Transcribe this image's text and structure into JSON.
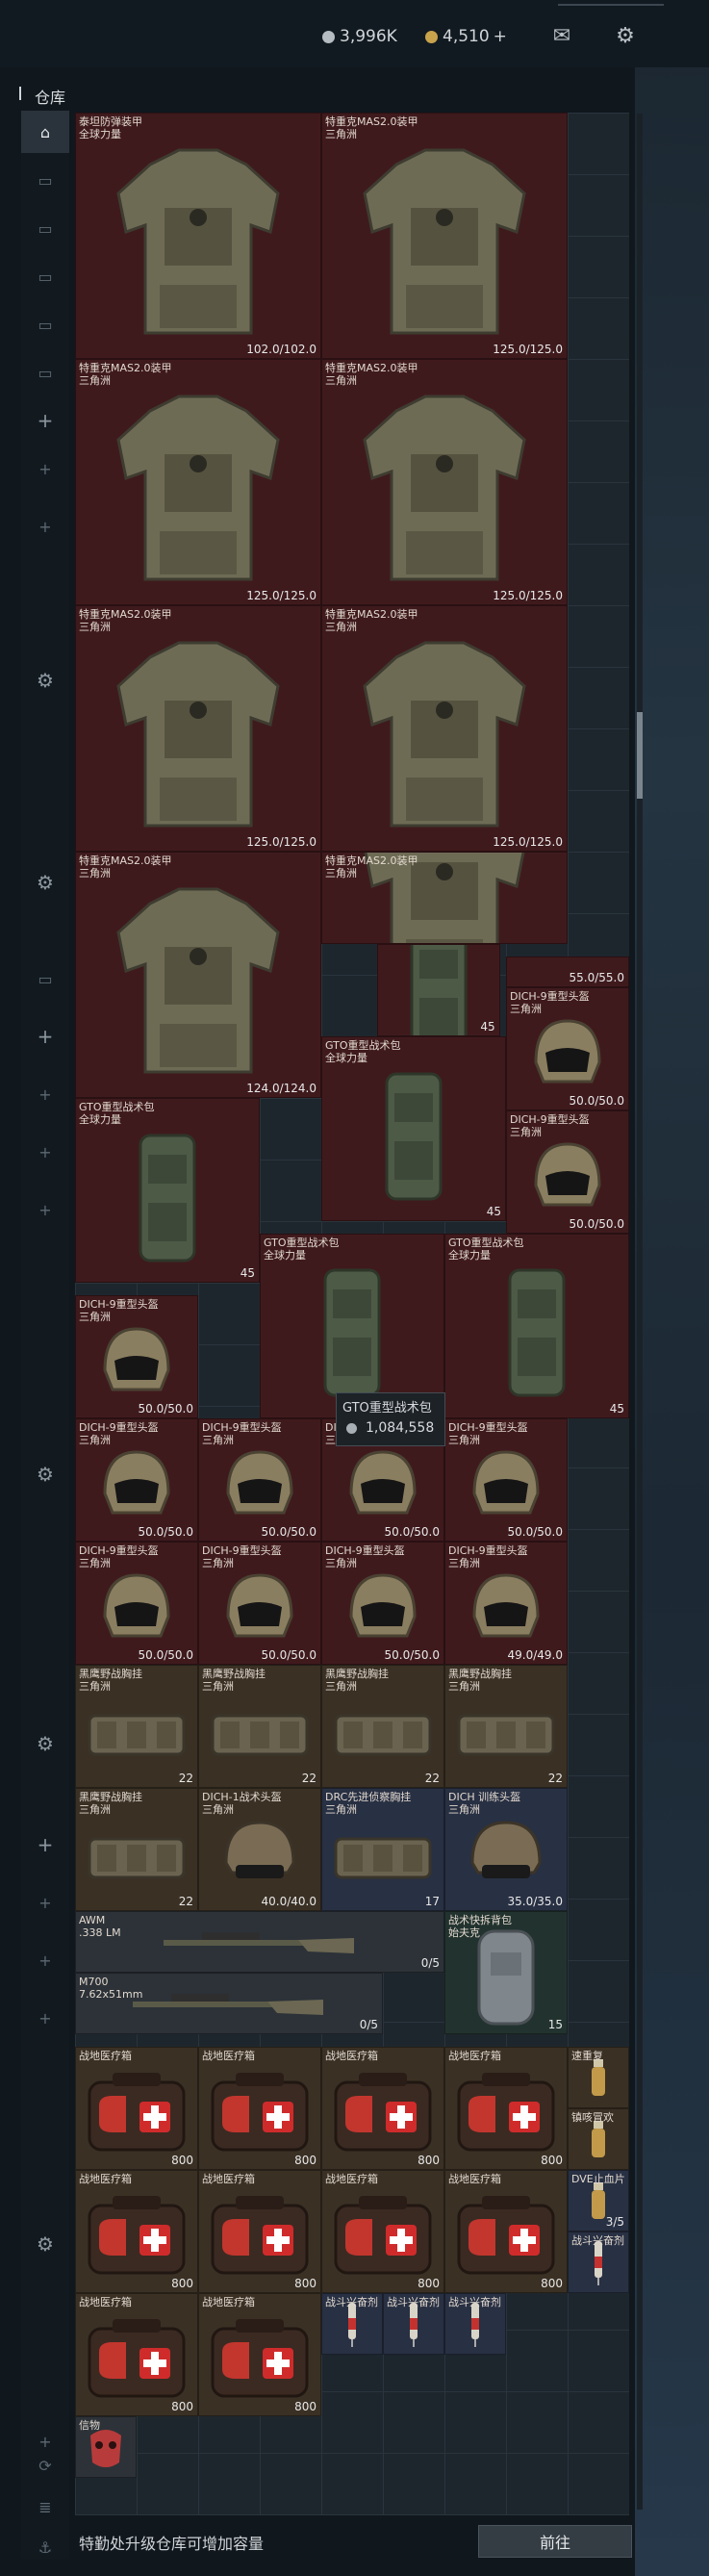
{
  "header": {
    "silver": "3,996K",
    "gold": "4,510",
    "gold_add": "+",
    "mail_icon": "mail-icon",
    "settings_icon": "gear-icon"
  },
  "title": "仓库",
  "tooltip": {
    "name": "GTO重型战术包",
    "price": "1,084,558"
  },
  "items": [
    {
      "n": "泰坦防弹装甲\n全球力量",
      "v": "102.0/102.0",
      "c": "red",
      "t": "vest",
      "x": 0,
      "y": 0,
      "w": 4,
      "h": 4
    },
    {
      "n": "特重克MAS2.0装甲\n三角洲",
      "v": "125.0/125.0",
      "c": "red",
      "t": "vest",
      "x": 4,
      "y": 0,
      "w": 4,
      "h": 4
    },
    {
      "n": "特重克MAS2.0装甲\n三角洲",
      "v": "125.0/125.0",
      "c": "red",
      "t": "vest",
      "x": 0,
      "y": 4,
      "w": 4,
      "h": 4
    },
    {
      "n": "特重克MAS2.0装甲\n三角洲",
      "v": "125.0/125.0",
      "c": "red",
      "t": "vest",
      "x": 4,
      "y": 4,
      "w": 4,
      "h": 4
    },
    {
      "n": "特重克MAS2.0装甲\n三角洲",
      "v": "125.0/125.0",
      "c": "red",
      "t": "vest",
      "x": 0,
      "y": 8,
      "w": 4,
      "h": 4
    },
    {
      "n": "特重克MAS2.0装甲\n三角洲",
      "v": "125.0/125.0",
      "c": "red",
      "t": "vest",
      "x": 4,
      "y": 8,
      "w": 4,
      "h": 4
    },
    {
      "n": "特重克MAS2.0装甲\n三角洲",
      "v": "124.0/124.0",
      "c": "red",
      "t": "vest",
      "x": 0,
      "y": 12,
      "w": 4,
      "h": 4
    },
    {
      "n": "特重克MAS2.0装甲\n三角洲",
      "v": "",
      "c": "red",
      "t": "vest",
      "x": 4,
      "y": 12,
      "w": 4,
      "h": 1.5
    },
    {
      "n": "",
      "v": "45",
      "c": "red",
      "t": "bag",
      "x": 4.9,
      "y": 13.5,
      "w": 2,
      "h": 1.5
    },
    {
      "n": "",
      "v": "55.0/55.0",
      "c": "red",
      "t": "none",
      "x": 7,
      "y": 13.7,
      "w": 2,
      "h": 0.5
    },
    {
      "n": "DICH-9重型头盔\n三角洲",
      "v": "50.0/50.0",
      "c": "red",
      "t": "helmet",
      "x": 7,
      "y": 14.2,
      "w": 2,
      "h": 2
    },
    {
      "n": "GTO重型战术包\n全球力量",
      "v": "45",
      "c": "red",
      "t": "bag",
      "x": 4,
      "y": 15,
      "w": 3,
      "h": 3
    },
    {
      "n": "DICH-9重型头盔\n三角洲",
      "v": "50.0/50.0",
      "c": "red",
      "t": "helmet",
      "x": 7,
      "y": 16.2,
      "w": 2,
      "h": 2
    },
    {
      "n": "GTO重型战术包\n全球力量",
      "v": "45",
      "c": "red",
      "t": "bag",
      "x": 0,
      "y": 16,
      "w": 3,
      "h": 3
    },
    {
      "n": "GTO重型战术包\n全球力量",
      "v": "",
      "c": "red",
      "t": "bag",
      "x": 3,
      "y": 18.2,
      "w": 3,
      "h": 3
    },
    {
      "n": "GTO重型战术包\n全球力量",
      "v": "45",
      "c": "red",
      "t": "bag",
      "x": 6,
      "y": 18.2,
      "w": 3,
      "h": 3
    },
    {
      "n": "DICH-9重型头盔\n三角洲",
      "v": "50.0/50.0",
      "c": "red",
      "t": "helmet",
      "x": 0,
      "y": 19.2,
      "w": 2,
      "h": 2
    },
    {
      "n": "DICH-9重型头盔\n三角洲",
      "v": "50.0/50.0",
      "c": "red",
      "t": "helmet",
      "x": 0,
      "y": 21.2,
      "w": 2,
      "h": 2
    },
    {
      "n": "DICH-9重型头盔\n三角洲",
      "v": "50.0/50.0",
      "c": "red",
      "t": "helmet",
      "x": 2,
      "y": 21.2,
      "w": 2,
      "h": 2
    },
    {
      "n": "DICH-9重型头盔\n三角洲",
      "v": "50.0/50.0",
      "c": "red",
      "t": "helmet",
      "x": 4,
      "y": 21.2,
      "w": 2,
      "h": 2
    },
    {
      "n": "DICH-9重型头盔\n三角洲",
      "v": "50.0/50.0",
      "c": "red",
      "t": "helmet",
      "x": 6,
      "y": 21.2,
      "w": 2,
      "h": 2
    },
    {
      "n": "DICH-9重型头盔\n三角洲",
      "v": "50.0/50.0",
      "c": "red",
      "t": "helmet",
      "x": 0,
      "y": 23.2,
      "w": 2,
      "h": 2
    },
    {
      "n": "DICH-9重型头盔\n三角洲",
      "v": "50.0/50.0",
      "c": "red",
      "t": "helmet",
      "x": 2,
      "y": 23.2,
      "w": 2,
      "h": 2
    },
    {
      "n": "DICH-9重型头盔\n三角洲",
      "v": "50.0/50.0",
      "c": "red",
      "t": "helmet",
      "x": 4,
      "y": 23.2,
      "w": 2,
      "h": 2
    },
    {
      "n": "DICH-9重型头盔\n三角洲",
      "v": "49.0/49.0",
      "c": "red",
      "t": "helmet",
      "x": 6,
      "y": 23.2,
      "w": 2,
      "h": 2
    },
    {
      "n": "黑鹰野战胸挂\n三角洲",
      "v": "22",
      "c": "brown",
      "t": "rig",
      "x": 0,
      "y": 25.2,
      "w": 2,
      "h": 2
    },
    {
      "n": "黑鹰野战胸挂\n三角洲",
      "v": "22",
      "c": "brown",
      "t": "rig",
      "x": 2,
      "y": 25.2,
      "w": 2,
      "h": 2
    },
    {
      "n": "黑鹰野战胸挂\n三角洲",
      "v": "22",
      "c": "brown",
      "t": "rig",
      "x": 4,
      "y": 25.2,
      "w": 2,
      "h": 2
    },
    {
      "n": "黑鹰野战胸挂\n三角洲",
      "v": "22",
      "c": "brown",
      "t": "rig",
      "x": 6,
      "y": 25.2,
      "w": 2,
      "h": 2
    },
    {
      "n": "黑鹰野战胸挂\n三角洲",
      "v": "22",
      "c": "brown",
      "t": "rig",
      "x": 0,
      "y": 27.2,
      "w": 2,
      "h": 2
    },
    {
      "n": "DICH-1战术头盔\n三角洲",
      "v": "40.0/40.0",
      "c": "brown",
      "t": "helmet2",
      "x": 2,
      "y": 27.2,
      "w": 2,
      "h": 2
    },
    {
      "n": "DRC先进侦察胸挂\n三角洲",
      "v": "17",
      "c": "blue",
      "t": "rig",
      "x": 4,
      "y": 27.2,
      "w": 2,
      "h": 2
    },
    {
      "n": "DICH 训练头盔\n三角洲",
      "v": "35.0/35.0",
      "c": "blue",
      "t": "helmet2",
      "x": 6,
      "y": 27.2,
      "w": 2,
      "h": 2
    },
    {
      "n": "AWM\n.338 LM",
      "v": "0/5",
      "c": "grey",
      "t": "rifle",
      "x": 0,
      "y": 29.2,
      "w": 6,
      "h": 1
    },
    {
      "n": "M700\n7.62x51mm",
      "v": "0/5",
      "c": "grey",
      "t": "rifle",
      "x": 0,
      "y": 30.2,
      "w": 5,
      "h": 1
    },
    {
      "n": "战术快拆背包\n始夫克",
      "v": "15",
      "c": "teal",
      "t": "pack",
      "x": 6,
      "y": 29.2,
      "w": 2,
      "h": 2
    },
    {
      "n": "战地医疗箱",
      "v": "800",
      "c": "brown",
      "t": "med",
      "x": 0,
      "y": 31.4,
      "w": 2,
      "h": 2
    },
    {
      "n": "战地医疗箱",
      "v": "800",
      "c": "brown",
      "t": "med",
      "x": 2,
      "y": 31.4,
      "w": 2,
      "h": 2
    },
    {
      "n": "战地医疗箱",
      "v": "800",
      "c": "brown",
      "t": "med",
      "x": 4,
      "y": 31.4,
      "w": 2,
      "h": 2
    },
    {
      "n": "战地医疗箱",
      "v": "800",
      "c": "brown",
      "t": "med",
      "x": 6,
      "y": 31.4,
      "w": 2,
      "h": 2
    },
    {
      "n": "战地医疗箱",
      "v": "800",
      "c": "brown",
      "t": "med",
      "x": 0,
      "y": 33.4,
      "w": 2,
      "h": 2
    },
    {
      "n": "战地医疗箱",
      "v": "800",
      "c": "brown",
      "t": "med",
      "x": 2,
      "y": 33.4,
      "w": 2,
      "h": 2
    },
    {
      "n": "战地医疗箱",
      "v": "800",
      "c": "brown",
      "t": "med",
      "x": 4,
      "y": 33.4,
      "w": 2,
      "h": 2
    },
    {
      "n": "战地医疗箱",
      "v": "800",
      "c": "brown",
      "t": "med",
      "x": 6,
      "y": 33.4,
      "w": 2,
      "h": 2
    },
    {
      "n": "战地医疗箱",
      "v": "800",
      "c": "brown",
      "t": "med",
      "x": 0,
      "y": 35.4,
      "w": 2,
      "h": 2
    },
    {
      "n": "战地医疗箱",
      "v": "800",
      "c": "brown",
      "t": "med",
      "x": 2,
      "y": 35.4,
      "w": 2,
      "h": 2
    },
    {
      "n": "速重复",
      "v": "",
      "c": "brown",
      "t": "vial",
      "x": 8,
      "y": 31.4,
      "w": 1,
      "h": 1
    },
    {
      "n": "镇咳冒欢",
      "v": "",
      "c": "brown",
      "t": "vial",
      "x": 8,
      "y": 32.4,
      "w": 1,
      "h": 1
    },
    {
      "n": "DVE止血片",
      "v": "3/5",
      "c": "blue",
      "t": "vial",
      "x": 8,
      "y": 33.4,
      "w": 1,
      "h": 1
    },
    {
      "n": "战斗兴奋剂",
      "v": "",
      "c": "blue",
      "t": "syringe",
      "x": 8,
      "y": 34.4,
      "w": 1,
      "h": 1
    },
    {
      "n": "战斗兴奋剂",
      "v": "",
      "c": "blue",
      "t": "syringe",
      "x": 4,
      "y": 35.4,
      "w": 1,
      "h": 1
    },
    {
      "n": "战斗兴奋剂",
      "v": "",
      "c": "blue",
      "t": "syringe",
      "x": 5,
      "y": 35.4,
      "w": 1,
      "h": 1
    },
    {
      "n": "战斗兴奋剂",
      "v": "",
      "c": "blue",
      "t": "syringe",
      "x": 6,
      "y": 35.4,
      "w": 1,
      "h": 1
    },
    {
      "n": "信物",
      "v": "",
      "c": "grey",
      "t": "mask",
      "x": 0,
      "y": 37.4,
      "w": 1,
      "h": 1
    }
  ],
  "footer": {
    "text": "特勤处升级仓库可增加容量",
    "button": "前往"
  }
}
